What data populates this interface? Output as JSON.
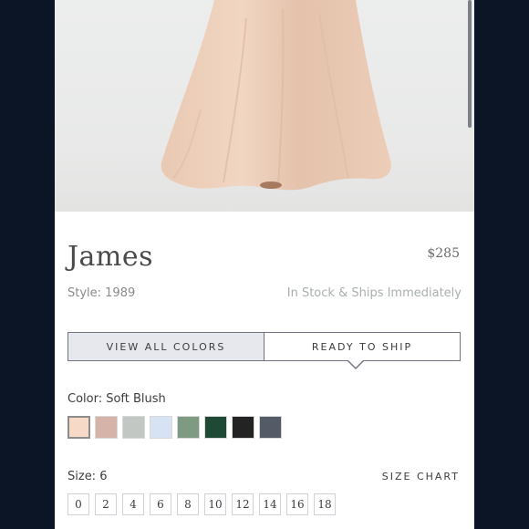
{
  "product": {
    "name": "James",
    "price": "$285",
    "style": "Style: 1989",
    "availability": "In Stock & Ships Immediately"
  },
  "tabs": [
    {
      "label": "VIEW ALL COLORS",
      "active": false
    },
    {
      "label": "READY TO SHIP",
      "active": true
    }
  ],
  "color": {
    "label": "Color: Soft Blush",
    "selected": "Soft Blush",
    "swatches": [
      "#f6d9c6",
      "#d6b3a8",
      "#c2c7c3",
      "#d7e3f2",
      "#7f9a83",
      "#1e4a35",
      "#232323",
      "#545a66"
    ]
  },
  "size": {
    "label": "Size: 6",
    "chart_link": "SIZE CHART",
    "options": [
      "0",
      "2",
      "4",
      "6",
      "8",
      "10",
      "12",
      "14",
      "16",
      "18"
    ]
  }
}
